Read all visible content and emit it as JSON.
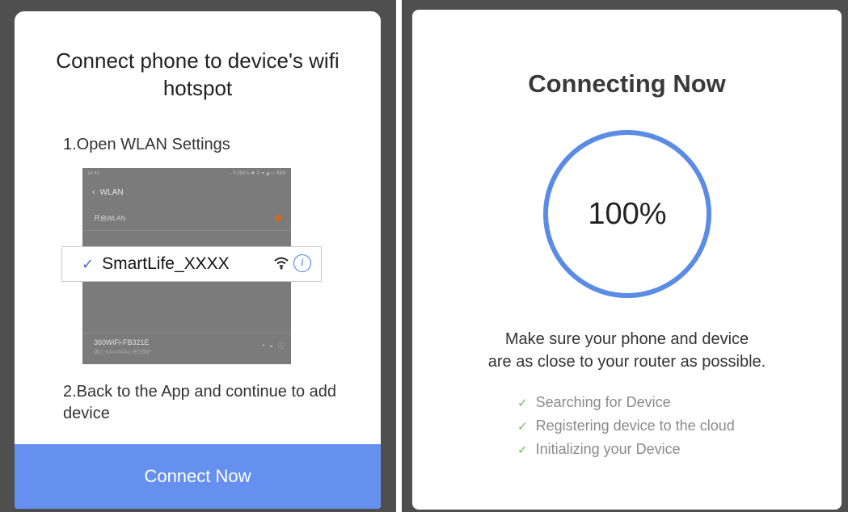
{
  "left_screen": {
    "title": "Connect phone to device's wifi hotspot",
    "step_1": "1.Open WLAN Settings",
    "step_2": "2.Back to the App and continue to add device",
    "button_label": "Connect Now",
    "wlan_screenshot": {
      "status_time": "14:41",
      "status_right": "... 0.09K/s ✱ ⊙ ▾ ◢ ▭ 98%",
      "header": "WLAN",
      "toggle_label": "开启WLAN",
      "other_ssid": "360WiFi-FB321E",
      "other_ssid_sub": "通过 WPA/WPA2 进行保护"
    },
    "highlighted_network": "SmartLife_XXXX"
  },
  "right_screen": {
    "title": "Connecting Now",
    "progress_value": 100,
    "progress_label": "100%",
    "hint_line_1": "Make sure your phone and device",
    "hint_line_2": "are as close to your router as possible.",
    "status_items": [
      "Searching for Device",
      "Registering device to the cloud",
      "Initializing your Device"
    ]
  },
  "colors": {
    "primary_blue": "#6690ef",
    "ring_blue": "#5a8ce6",
    "check_green": "#6cbf5a",
    "frame_gray": "#4f4f4f"
  },
  "icons": {
    "check_mark": "check-icon",
    "wifi": "wifi-icon",
    "info": "info-icon",
    "back_arrow": "back-chevron-icon"
  }
}
